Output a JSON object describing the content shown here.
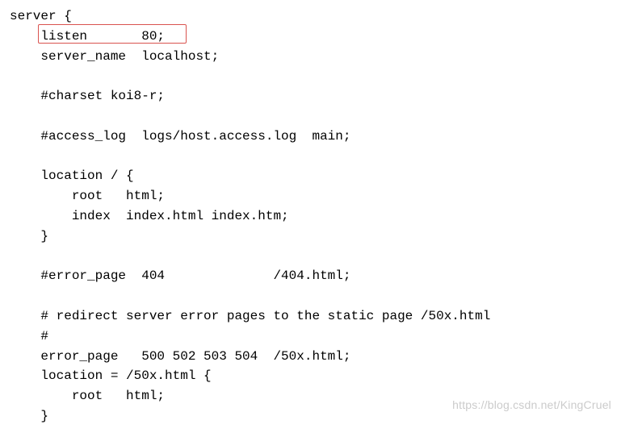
{
  "code": {
    "lines": [
      "server {",
      "    listen       80;",
      "    server_name  localhost;",
      "",
      "    #charset koi8-r;",
      "",
      "    #access_log  logs/host.access.log  main;",
      "",
      "    location / {",
      "        root   html;",
      "        index  index.html index.htm;",
      "    }",
      "",
      "    #error_page  404              /404.html;",
      "",
      "    # redirect server error pages to the static page /50x.html",
      "    #",
      "    error_page   500 502 503 504  /50x.html;",
      "    location = /50x.html {",
      "        root   html;",
      "    }"
    ]
  },
  "highlight": {
    "description": "listen 80 directive"
  },
  "watermark": "https://blog.csdn.net/KingCruel"
}
